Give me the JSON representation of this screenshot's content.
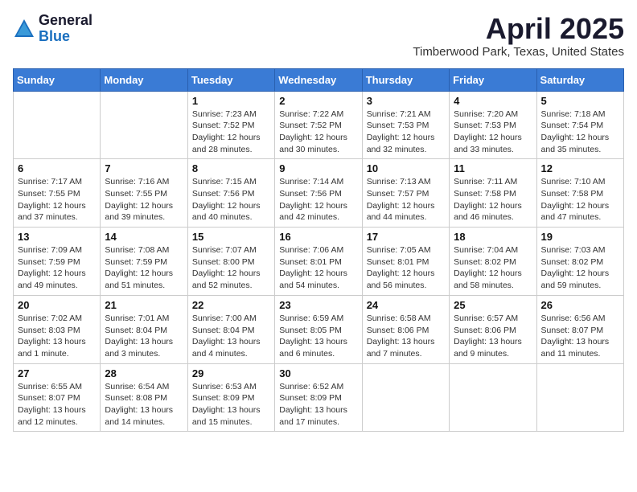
{
  "header": {
    "logo_general": "General",
    "logo_blue": "Blue",
    "month_year": "April 2025",
    "location": "Timberwood Park, Texas, United States"
  },
  "days_of_week": [
    "Sunday",
    "Monday",
    "Tuesday",
    "Wednesday",
    "Thursday",
    "Friday",
    "Saturday"
  ],
  "weeks": [
    [
      {
        "day": "",
        "info": ""
      },
      {
        "day": "",
        "info": ""
      },
      {
        "day": "1",
        "info": "Sunrise: 7:23 AM\nSunset: 7:52 PM\nDaylight: 12 hours\nand 28 minutes."
      },
      {
        "day": "2",
        "info": "Sunrise: 7:22 AM\nSunset: 7:52 PM\nDaylight: 12 hours\nand 30 minutes."
      },
      {
        "day": "3",
        "info": "Sunrise: 7:21 AM\nSunset: 7:53 PM\nDaylight: 12 hours\nand 32 minutes."
      },
      {
        "day": "4",
        "info": "Sunrise: 7:20 AM\nSunset: 7:53 PM\nDaylight: 12 hours\nand 33 minutes."
      },
      {
        "day": "5",
        "info": "Sunrise: 7:18 AM\nSunset: 7:54 PM\nDaylight: 12 hours\nand 35 minutes."
      }
    ],
    [
      {
        "day": "6",
        "info": "Sunrise: 7:17 AM\nSunset: 7:55 PM\nDaylight: 12 hours\nand 37 minutes."
      },
      {
        "day": "7",
        "info": "Sunrise: 7:16 AM\nSunset: 7:55 PM\nDaylight: 12 hours\nand 39 minutes."
      },
      {
        "day": "8",
        "info": "Sunrise: 7:15 AM\nSunset: 7:56 PM\nDaylight: 12 hours\nand 40 minutes."
      },
      {
        "day": "9",
        "info": "Sunrise: 7:14 AM\nSunset: 7:56 PM\nDaylight: 12 hours\nand 42 minutes."
      },
      {
        "day": "10",
        "info": "Sunrise: 7:13 AM\nSunset: 7:57 PM\nDaylight: 12 hours\nand 44 minutes."
      },
      {
        "day": "11",
        "info": "Sunrise: 7:11 AM\nSunset: 7:58 PM\nDaylight: 12 hours\nand 46 minutes."
      },
      {
        "day": "12",
        "info": "Sunrise: 7:10 AM\nSunset: 7:58 PM\nDaylight: 12 hours\nand 47 minutes."
      }
    ],
    [
      {
        "day": "13",
        "info": "Sunrise: 7:09 AM\nSunset: 7:59 PM\nDaylight: 12 hours\nand 49 minutes."
      },
      {
        "day": "14",
        "info": "Sunrise: 7:08 AM\nSunset: 7:59 PM\nDaylight: 12 hours\nand 51 minutes."
      },
      {
        "day": "15",
        "info": "Sunrise: 7:07 AM\nSunset: 8:00 PM\nDaylight: 12 hours\nand 52 minutes."
      },
      {
        "day": "16",
        "info": "Sunrise: 7:06 AM\nSunset: 8:01 PM\nDaylight: 12 hours\nand 54 minutes."
      },
      {
        "day": "17",
        "info": "Sunrise: 7:05 AM\nSunset: 8:01 PM\nDaylight: 12 hours\nand 56 minutes."
      },
      {
        "day": "18",
        "info": "Sunrise: 7:04 AM\nSunset: 8:02 PM\nDaylight: 12 hours\nand 58 minutes."
      },
      {
        "day": "19",
        "info": "Sunrise: 7:03 AM\nSunset: 8:02 PM\nDaylight: 12 hours\nand 59 minutes."
      }
    ],
    [
      {
        "day": "20",
        "info": "Sunrise: 7:02 AM\nSunset: 8:03 PM\nDaylight: 13 hours\nand 1 minute."
      },
      {
        "day": "21",
        "info": "Sunrise: 7:01 AM\nSunset: 8:04 PM\nDaylight: 13 hours\nand 3 minutes."
      },
      {
        "day": "22",
        "info": "Sunrise: 7:00 AM\nSunset: 8:04 PM\nDaylight: 13 hours\nand 4 minutes."
      },
      {
        "day": "23",
        "info": "Sunrise: 6:59 AM\nSunset: 8:05 PM\nDaylight: 13 hours\nand 6 minutes."
      },
      {
        "day": "24",
        "info": "Sunrise: 6:58 AM\nSunset: 8:06 PM\nDaylight: 13 hours\nand 7 minutes."
      },
      {
        "day": "25",
        "info": "Sunrise: 6:57 AM\nSunset: 8:06 PM\nDaylight: 13 hours\nand 9 minutes."
      },
      {
        "day": "26",
        "info": "Sunrise: 6:56 AM\nSunset: 8:07 PM\nDaylight: 13 hours\nand 11 minutes."
      }
    ],
    [
      {
        "day": "27",
        "info": "Sunrise: 6:55 AM\nSunset: 8:07 PM\nDaylight: 13 hours\nand 12 minutes."
      },
      {
        "day": "28",
        "info": "Sunrise: 6:54 AM\nSunset: 8:08 PM\nDaylight: 13 hours\nand 14 minutes."
      },
      {
        "day": "29",
        "info": "Sunrise: 6:53 AM\nSunset: 8:09 PM\nDaylight: 13 hours\nand 15 minutes."
      },
      {
        "day": "30",
        "info": "Sunrise: 6:52 AM\nSunset: 8:09 PM\nDaylight: 13 hours\nand 17 minutes."
      },
      {
        "day": "",
        "info": ""
      },
      {
        "day": "",
        "info": ""
      },
      {
        "day": "",
        "info": ""
      }
    ]
  ]
}
